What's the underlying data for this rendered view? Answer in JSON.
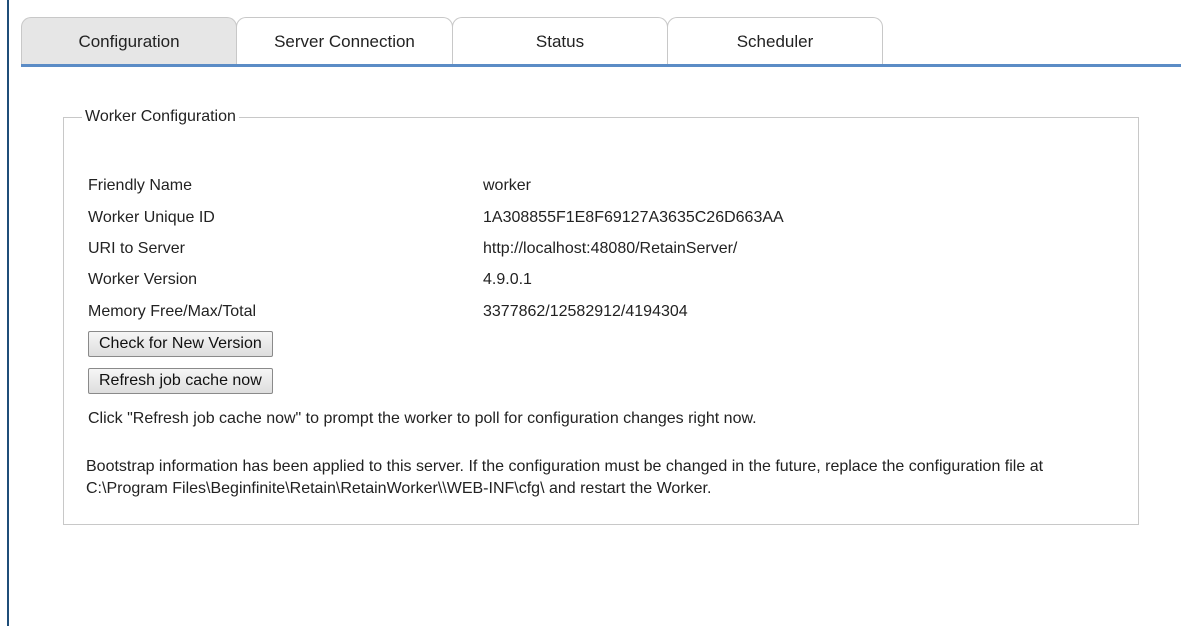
{
  "tabs": [
    {
      "label": "Configuration",
      "active": true
    },
    {
      "label": "Server Connection",
      "active": false
    },
    {
      "label": "Status",
      "active": false
    },
    {
      "label": "Scheduler",
      "active": false
    }
  ],
  "worker_config": {
    "legend": "Worker Configuration",
    "fields": [
      {
        "label": "Friendly Name",
        "value": "worker"
      },
      {
        "label": "Worker Unique ID",
        "value": "1A308855F1E8F69127A3635C26D663AA"
      },
      {
        "label": "URI to Server",
        "value": "http://localhost:48080/RetainServer/"
      },
      {
        "label": "Worker Version",
        "value": "4.9.0.1"
      },
      {
        "label": "Memory Free/Max/Total",
        "value": "3377862/12582912/4194304"
      }
    ],
    "check_version_label": "Check for New Version",
    "refresh_cache_label": "Refresh job cache now",
    "refresh_help": "Click \"Refresh job cache now\" to prompt the worker to poll for configuration changes right now.",
    "bootstrap_info": "Bootstrap information has been applied to this server. If the configuration must be changed in the future, replace the configuration file at C:\\Program Files\\Beginfinite\\Retain\\RetainWorker\\\\WEB-INF\\cfg\\ and restart the Worker."
  },
  "colors": {
    "tab_underline": "#5b8cc6",
    "active_tab_bg": "#e6e6e6",
    "left_border": "#1f4e79"
  }
}
